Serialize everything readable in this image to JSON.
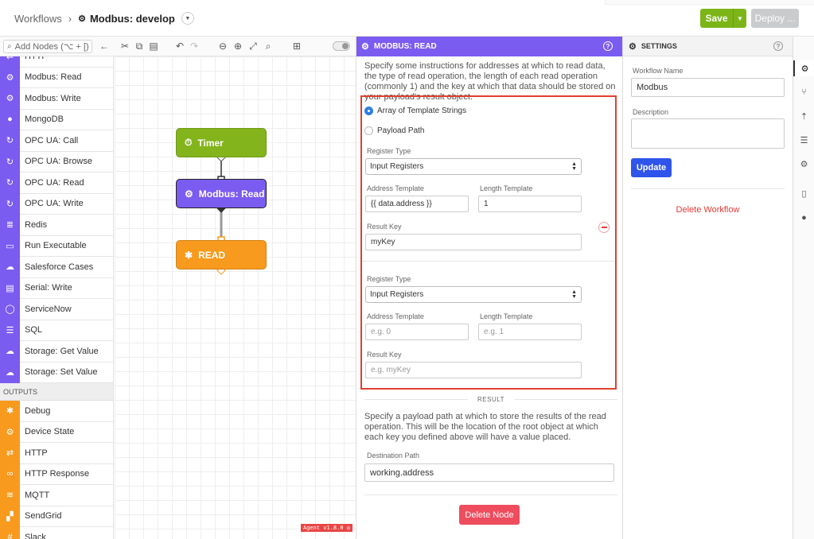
{
  "breadcrumb": {
    "root": "Workflows",
    "current": "Modbus: develop"
  },
  "header": {
    "save_label": "Save",
    "deploy_label": "Deploy ..."
  },
  "toolbar": {
    "search_placeholder": "Add Nodes (⌥ + [)"
  },
  "palette": {
    "top_items": [
      {
        "label": "HTTP",
        "icon": "http-icon",
        "color": "#7b5cf0"
      },
      {
        "label": "Modbus: Read",
        "icon": "modbus-icon",
        "color": "#7b5cf0"
      },
      {
        "label": "Modbus: Write",
        "icon": "modbus-icon",
        "color": "#7b5cf0"
      },
      {
        "label": "MongoDB",
        "icon": "mongodb-icon",
        "color": "#7b5cf0"
      },
      {
        "label": "OPC UA: Call",
        "icon": "opcua-icon",
        "color": "#7b5cf0"
      },
      {
        "label": "OPC UA: Browse",
        "icon": "opcua-icon",
        "color": "#7b5cf0"
      },
      {
        "label": "OPC UA: Read",
        "icon": "opcua-icon",
        "color": "#7b5cf0"
      },
      {
        "label": "OPC UA: Write",
        "icon": "opcua-icon",
        "color": "#7b5cf0"
      },
      {
        "label": "Redis",
        "icon": "redis-icon",
        "color": "#7b5cf0"
      },
      {
        "label": "Run Executable",
        "icon": "terminal-icon",
        "color": "#7b5cf0"
      },
      {
        "label": "Salesforce Cases",
        "icon": "salesforce-icon",
        "color": "#7b5cf0"
      },
      {
        "label": "Serial: Write",
        "icon": "serial-icon",
        "color": "#7b5cf0"
      },
      {
        "label": "ServiceNow",
        "icon": "servicenow-icon",
        "color": "#7b5cf0"
      },
      {
        "label": "SQL",
        "icon": "database-icon",
        "color": "#7b5cf0"
      },
      {
        "label": "Storage: Get Value",
        "icon": "cloud-icon",
        "color": "#7b5cf0"
      },
      {
        "label": "Storage: Set Value",
        "icon": "cloud-icon",
        "color": "#7b5cf0"
      }
    ],
    "outputs_header": "OUTPUTS",
    "output_items": [
      {
        "label": "Debug",
        "icon": "bug-icon",
        "color": "#f79a1d"
      },
      {
        "label": "Device State",
        "icon": "device-icon",
        "color": "#f79a1d"
      },
      {
        "label": "HTTP",
        "icon": "http-icon",
        "color": "#f79a1d"
      },
      {
        "label": "HTTP Response",
        "icon": "link-icon",
        "color": "#f79a1d"
      },
      {
        "label": "MQTT",
        "icon": "mqtt-icon",
        "color": "#f79a1d"
      },
      {
        "label": "SendGrid",
        "icon": "sendgrid-icon",
        "color": "#f79a1d"
      },
      {
        "label": "Slack",
        "icon": "slack-icon",
        "color": "#f79a1d"
      }
    ]
  },
  "canvas": {
    "nodes": [
      {
        "label": "Timer",
        "icon": "timer-icon",
        "color": "#84b41c"
      },
      {
        "label": "Modbus: Read",
        "icon": "modbus-icon",
        "color": "#7b5cf0"
      },
      {
        "label": "READ",
        "icon": "bug-icon",
        "color": "#f79a1d"
      }
    ],
    "version": "Agent v1.8.0 ◎"
  },
  "node_panel": {
    "title": "MODBUS: READ",
    "description": "Specify some instructions for addresses at which to read data, the type of read operation, the length of each read operation (commonly 1) and the key at which that data should be stored on your payload's result object.",
    "radio_templates": "Array of Template Strings",
    "radio_payload": "Payload Path",
    "entries": [
      {
        "register_type_label": "Register Type",
        "register_type": "Input Registers",
        "address_label": "Address Template",
        "address_value": "{{ data.address }}",
        "address_placeholder": "",
        "length_label": "Length Template",
        "length_value": "1",
        "length_placeholder": "",
        "result_key_label": "Result Key",
        "result_key_value": "myKey",
        "result_key_placeholder": ""
      },
      {
        "register_type_label": "Register Type",
        "register_type": "Input Registers",
        "address_label": "Address Template",
        "address_value": "",
        "address_placeholder": "e.g. 0",
        "length_label": "Length Template",
        "length_value": "",
        "length_placeholder": "e.g. 1",
        "result_key_label": "Result Key",
        "result_key_value": "",
        "result_key_placeholder": "e.g. myKey"
      }
    ],
    "result_header": "RESULT",
    "result_description": "Specify a payload path at which to store the results of the read operation. This will be the location of the root object at which each key you defined above will have a value placed.",
    "destination_label": "Destination Path",
    "destination_value": "working.address",
    "delete_label": "Delete Node"
  },
  "settings": {
    "title": "SETTINGS",
    "name_label": "Workflow Name",
    "name_value": "Modbus",
    "description_label": "Description",
    "description_value": "",
    "update_label": "Update",
    "delete_label": "Delete Workflow"
  },
  "colors": {
    "accent_purple": "#7b5cf0",
    "save_green": "#7cb518",
    "danger_red": "#e53935",
    "update_blue": "#2f54eb"
  }
}
